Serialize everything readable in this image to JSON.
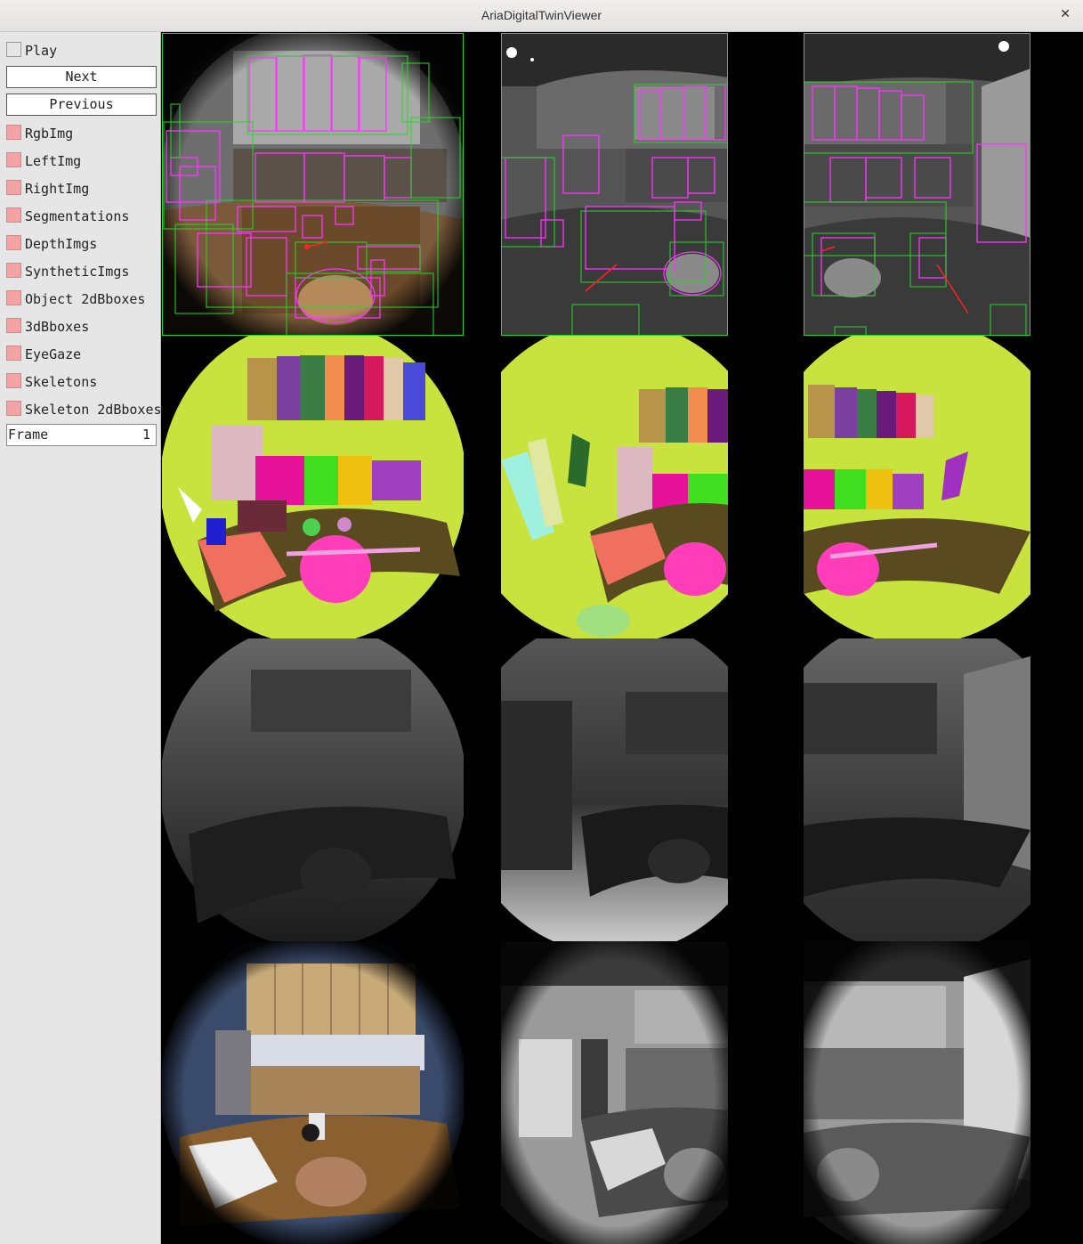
{
  "window": {
    "title": "AriaDigitalTwinViewer",
    "close_glyph": "✕"
  },
  "controls": {
    "play_label": "Play",
    "next_label": "Next",
    "previous_label": "Previous",
    "toggles": [
      {
        "label": "RgbImg",
        "checked": true
      },
      {
        "label": "LeftImg",
        "checked": true
      },
      {
        "label": "RightImg",
        "checked": true
      },
      {
        "label": "Segmentations",
        "checked": true
      },
      {
        "label": "DepthImgs",
        "checked": true
      },
      {
        "label": "SyntheticImgs",
        "checked": true
      },
      {
        "label": "Object 2dBboxes",
        "checked": true
      },
      {
        "label": "3dBboxes",
        "checked": true
      },
      {
        "label": "EyeGaze",
        "checked": true
      },
      {
        "label": "Skeletons",
        "checked": true
      },
      {
        "label": "Skeleton 2dBboxes",
        "checked": true
      }
    ],
    "frame_label": "Frame",
    "frame_value": "1"
  },
  "colors": {
    "checkbox_on": "#f3a3a3",
    "bbox_2d": "#27d627",
    "bbox_3d": "#ff33ff",
    "gaze": "#ff2222"
  },
  "views": {
    "rows": [
      "rgb-with-boxes",
      "segmentation",
      "depth",
      "synthetic"
    ],
    "columns": [
      "rgb",
      "left-slam",
      "right-slam"
    ]
  }
}
